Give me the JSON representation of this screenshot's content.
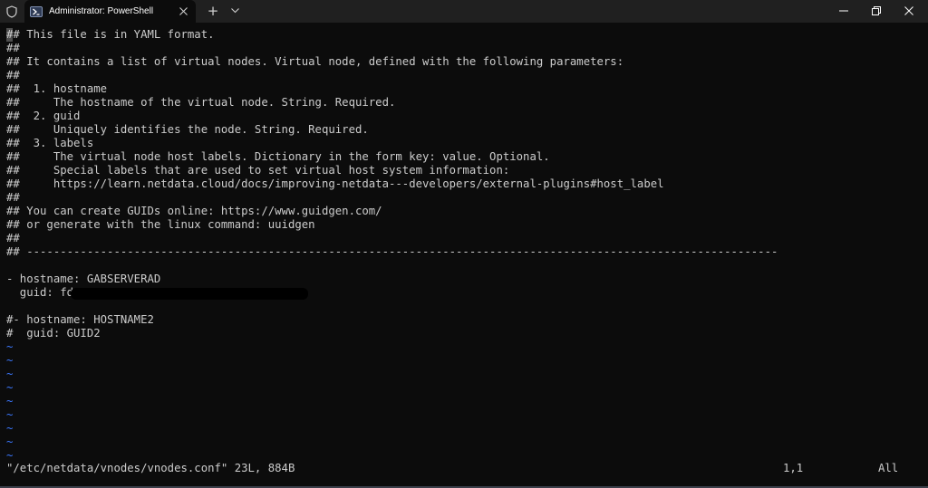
{
  "window": {
    "tab_title": "Administrator: PowerShell",
    "new_tab_glyph": "+",
    "icons": {
      "shield": "shield-icon",
      "tab": "powershell-icon",
      "close": "close-icon",
      "dropdown": "chevron-down-icon",
      "minimize": "minimize-icon",
      "maximize": "restore-icon",
      "window_close": "window-close-icon"
    }
  },
  "editor": {
    "lines": [
      "## This file is in YAML format.",
      "##",
      "## It contains a list of virtual nodes. Virtual node, defined with the following parameters:",
      "##",
      "##  1. hostname",
      "##     The hostname of the virtual node. String. Required.",
      "##  2. guid",
      "##     Uniquely identifies the node. String. Required.",
      "##  3. labels",
      "##     The virtual node host labels. Dictionary in the form key: value. Optional.",
      "##     Special labels that are used to set virtual host system information:",
      "##     https://learn.netdata.cloud/docs/improving-netdata---developers/external-plugins#host_label",
      "##",
      "## You can create GUIDs online: https://www.guidgen.com/",
      "## or generate with the linux command: uuidgen",
      "##",
      "## ----------------------------------------------------------------------------------------------------------------",
      "",
      "- hostname: GABSERVERAD",
      "  guid: fd",
      "",
      "#- hostname: HOSTNAME2",
      "#  guid: GUID2",
      "~",
      "~",
      "~",
      "~",
      "~",
      "~",
      "~",
      "~",
      "~"
    ],
    "status": {
      "file": "\"/etc/netdata/vnodes/vnodes.conf\" 23L, 884B",
      "position": "1,1",
      "scroll": "All"
    },
    "colors": {
      "text": "#cccccc",
      "tilde": "#3b78ff",
      "background": "#0c0c0c"
    }
  }
}
